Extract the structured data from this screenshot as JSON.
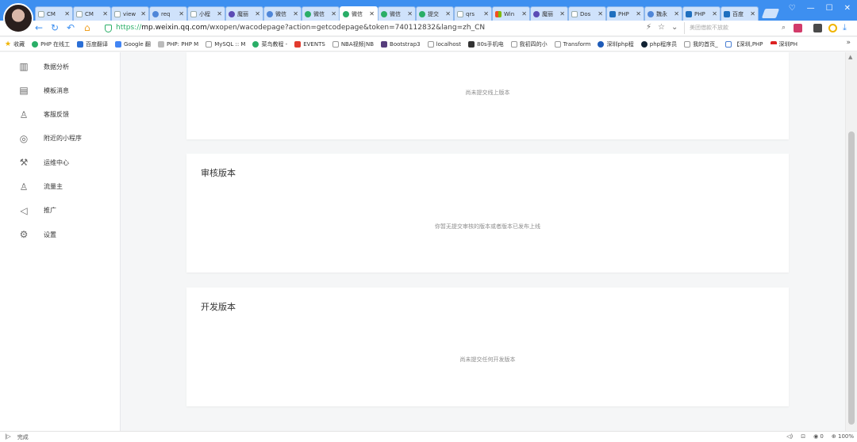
{
  "browser": {
    "tabs": [
      {
        "label": "CM",
        "icon": "page"
      },
      {
        "label": "CM",
        "icon": "page"
      },
      {
        "label": "view",
        "icon": "page"
      },
      {
        "label": "req",
        "icon": "gear"
      },
      {
        "label": "小程",
        "icon": "page"
      },
      {
        "label": "魔丽",
        "icon": "purple"
      },
      {
        "label": "微信",
        "icon": "gear"
      },
      {
        "label": "微信",
        "icon": "green"
      },
      {
        "label": "微信",
        "icon": "green",
        "active": true
      },
      {
        "label": "微信",
        "icon": "green"
      },
      {
        "label": "提交",
        "icon": "green"
      },
      {
        "label": "qrs",
        "icon": "page"
      },
      {
        "label": "Win",
        "icon": "win"
      },
      {
        "label": "魔丽",
        "icon": "purple"
      },
      {
        "label": "Dos",
        "icon": "page"
      },
      {
        "label": "PHP",
        "icon": "sq"
      },
      {
        "label": "魏永",
        "icon": "gear"
      },
      {
        "label": "PHP",
        "icon": "sq"
      },
      {
        "label": "百度",
        "icon": "sq"
      }
    ],
    "tab_close": "✕",
    "window_controls": [
      "♡",
      "—",
      "☐",
      "✕"
    ],
    "url_prefix": "https://",
    "url_domain": "mp.weixin.qq.com",
    "url_path": "/wxopen/wacodepage?action=getcodepage&token=740112832&lang=zh_CN",
    "search_placeholder": "美团借款不放款",
    "bookmarks": [
      {
        "label": "收藏",
        "icon": "star"
      },
      {
        "label": "PHP 在线工",
        "icon": "php"
      },
      {
        "label": "百度翻译",
        "icon": "baidu"
      },
      {
        "label": "Google 翻",
        "icon": "g"
      },
      {
        "label": "PHP: PHP M",
        "icon": "sq"
      },
      {
        "label": "MySQL :: M",
        "icon": "page"
      },
      {
        "label": "菜鸟教程 -",
        "icon": "php"
      },
      {
        "label": "EVENTS",
        "icon": "red"
      },
      {
        "label": "NBA视频|NB",
        "icon": "page"
      },
      {
        "label": "Bootstrap3",
        "icon": "bs"
      },
      {
        "label": "localhost",
        "icon": "page"
      },
      {
        "label": "80s手机电",
        "icon": "film"
      },
      {
        "label": "我初四的小",
        "icon": "page"
      },
      {
        "label": "Transform",
        "icon": "page"
      },
      {
        "label": "深圳php程",
        "icon": "blue"
      },
      {
        "label": "php程序员",
        "icon": "dark"
      },
      {
        "label": "我的首页_",
        "icon": "page"
      },
      {
        "label": "【深圳,PHP",
        "icon": "hand"
      },
      {
        "label": "深圳PH",
        "icon": "flag"
      }
    ],
    "bookmarks_more": "»"
  },
  "sidebar": {
    "items": [
      {
        "label": "数据分析",
        "icon": "chart-icon",
        "glyph": "▥"
      },
      {
        "label": "模板消息",
        "icon": "document-icon",
        "glyph": "▤"
      },
      {
        "label": "客服反馈",
        "icon": "user-icon",
        "glyph": "♙"
      },
      {
        "label": "附近的小程序",
        "icon": "location-icon",
        "glyph": "◎"
      },
      {
        "label": "运维中心",
        "icon": "wrench-icon",
        "glyph": "⚒"
      },
      {
        "label": "流量主",
        "icon": "user-money-icon",
        "glyph": "♙"
      },
      {
        "label": "推广",
        "icon": "megaphone-icon",
        "glyph": "◁"
      },
      {
        "label": "设置",
        "icon": "gear-icon",
        "glyph": "⚙"
      }
    ]
  },
  "main": {
    "online_card": {
      "empty_text": "尚未提交线上版本"
    },
    "review_card": {
      "title": "审核版本",
      "empty_text": "你暂无提交审核的版本或者版本已发布上线"
    },
    "dev_card": {
      "title": "开发版本",
      "empty_text": "尚未提交任何开发版本"
    }
  },
  "status": {
    "left_text": "完成",
    "zoom": "100%",
    "counter": "0"
  },
  "colors": {
    "accent": "#3d8ff0",
    "wechat_green": "#2aae67"
  }
}
